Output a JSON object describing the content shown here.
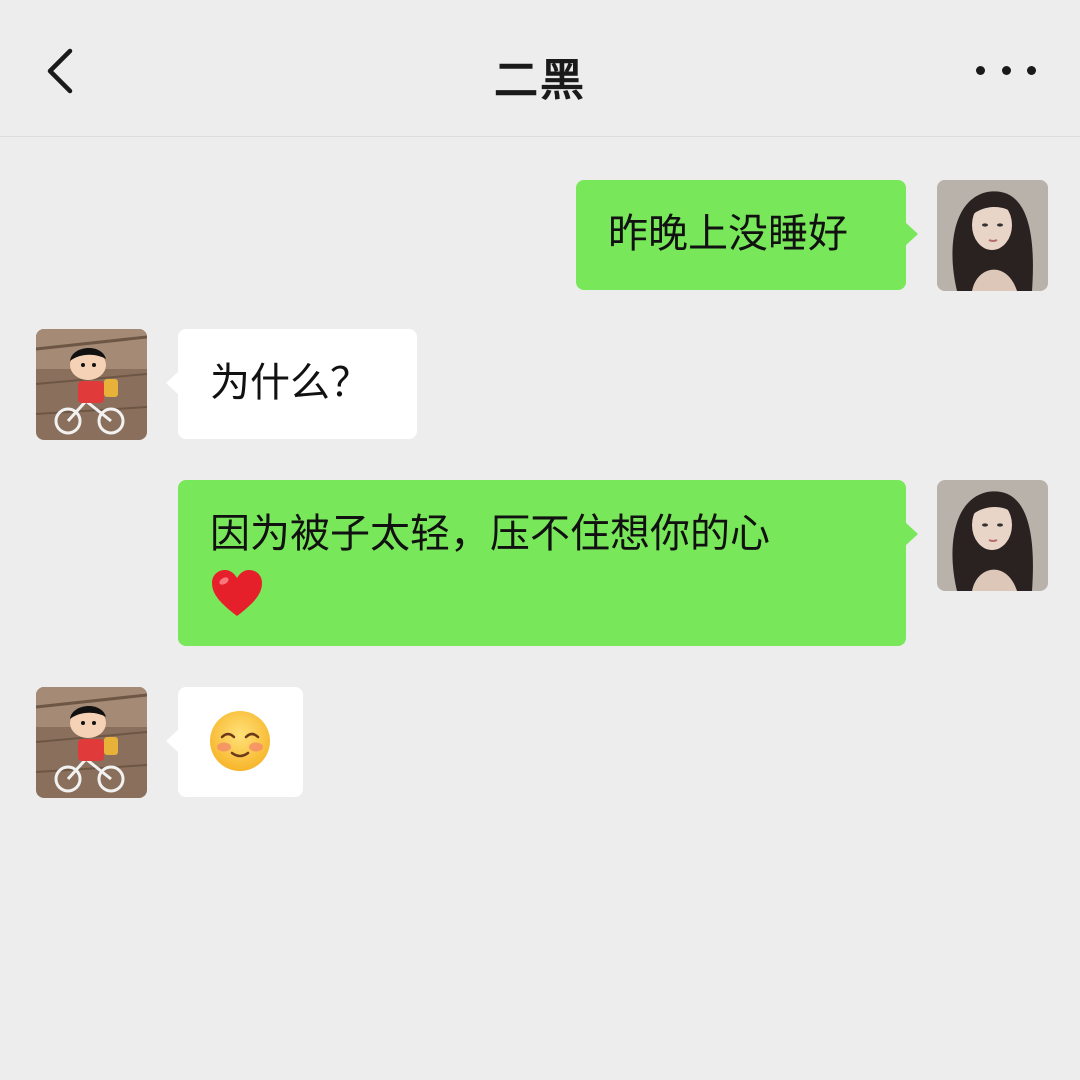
{
  "header": {
    "title": "二黑",
    "back_icon": "chevron-left-icon",
    "more_icon": "more-dots-icon"
  },
  "messages": [
    {
      "from": "me",
      "text": "昨晚上没睡好"
    },
    {
      "from": "them",
      "text": "为什么？"
    },
    {
      "from": "me",
      "text": "因为被子太轻，压不住想你的心",
      "emoji": "heart-icon"
    },
    {
      "from": "them",
      "emoji": "blushing-smile-emoji"
    }
  ],
  "colors": {
    "background": "#ededed",
    "my_bubble": "#79e75a",
    "their_bubble": "#ffffff"
  }
}
